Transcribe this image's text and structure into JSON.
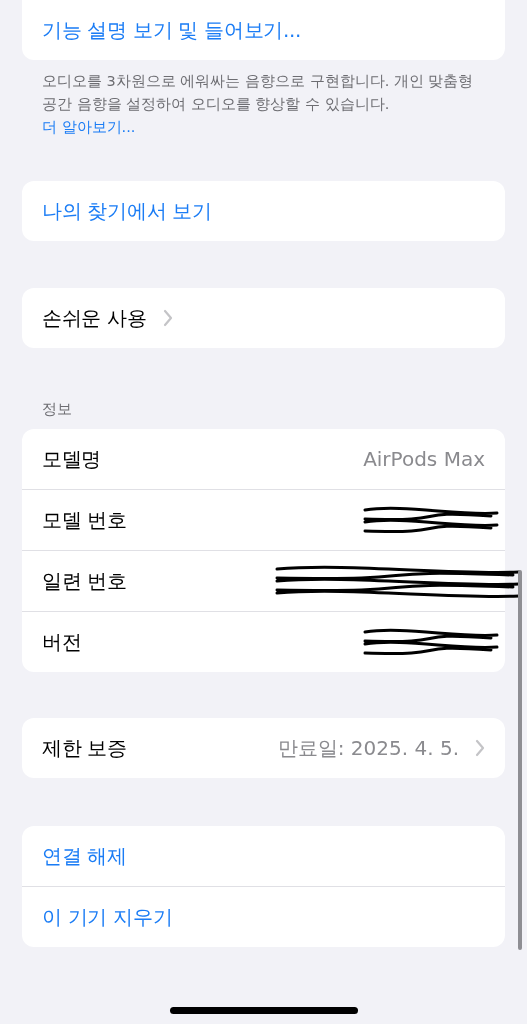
{
  "top_card": {
    "link": "기능 설명 보기 및 들어보기..."
  },
  "spatial_footer": {
    "text": "오디오를 3차원으로 에워싸는 음향으로 구현합니다. 개인 맞춤형 공간 음향을 설정하여 오디오를 향상할 수 있습니다.",
    "link": "더 알아보기..."
  },
  "find_my": {
    "link": "나의 찾기에서 보기"
  },
  "accessibility": {
    "label": "손쉬운 사용"
  },
  "info": {
    "header": "정보",
    "rows": [
      {
        "label": "모델명",
        "value": "AirPods Max",
        "redacted": false
      },
      {
        "label": "모델 번호",
        "redacted": true
      },
      {
        "label": "일련 번호",
        "redacted": true
      },
      {
        "label": "버전",
        "redacted": true
      }
    ]
  },
  "warranty": {
    "label": "제한 보증",
    "value": "만료일: 2025. 4. 5."
  },
  "actions": [
    "연결 해제",
    "이 기기 지우기"
  ]
}
